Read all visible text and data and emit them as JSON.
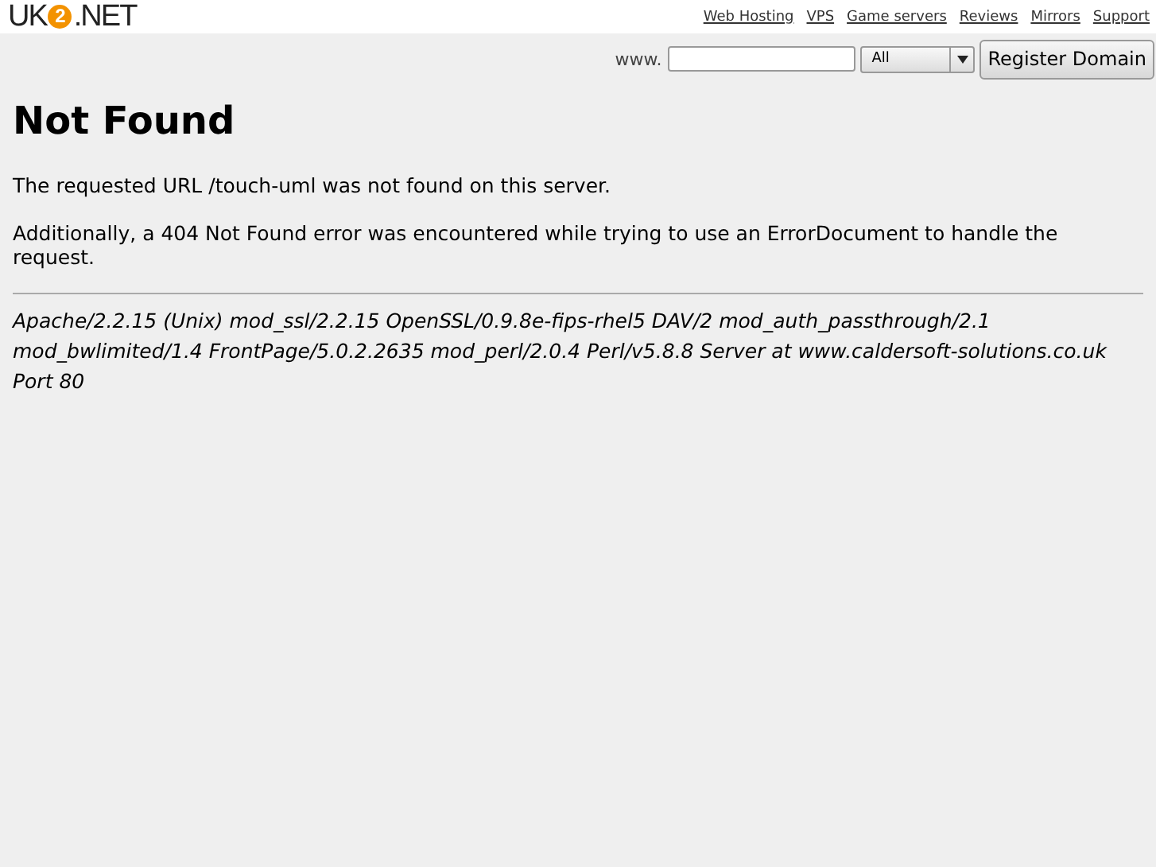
{
  "header": {
    "logo": {
      "left": "UK",
      "badge": "2",
      "right": ".NET"
    },
    "links": [
      "Web Hosting",
      "VPS",
      "Game servers",
      "Reviews",
      "Mirrors",
      "Support"
    ]
  },
  "domain_search": {
    "prefix": "www.",
    "select_value": "All",
    "button": "Register Domain"
  },
  "title": "Not Found",
  "paragraphs": [
    "The requested URL /touch-uml was not found on this server.",
    "Additionally, a 404 Not Found error was encountered while trying to use an ErrorDocument to handle the request."
  ],
  "server_signature": "Apache/2.2.15 (Unix) mod_ssl/2.2.15 OpenSSL/0.9.8e-fips-rhel5 DAV/2 mod_auth_passthrough/2.1 mod_bwlimited/1.4 FrontPage/5.0.2.2635 mod_perl/2.0.4 Perl/v5.8.8 Server at www.caldersoft-solutions.co.uk Port 80"
}
